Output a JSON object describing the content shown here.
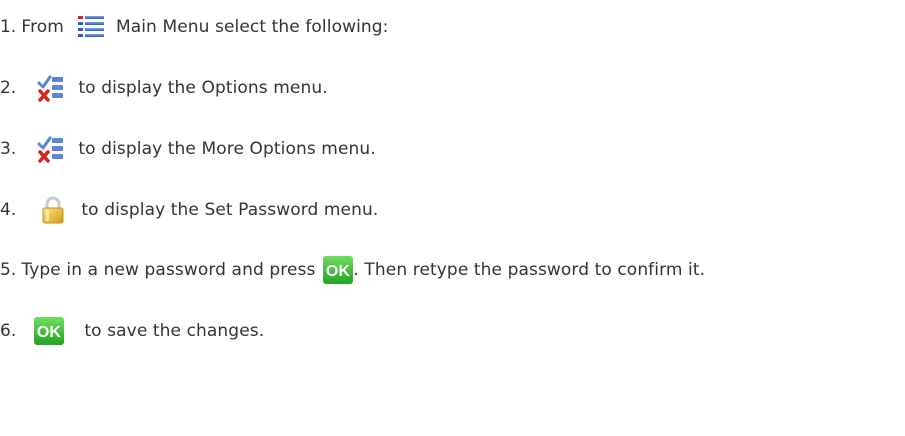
{
  "steps": [
    {
      "number": "1.",
      "prefix": "From",
      "icon": "main-menu-icon",
      "text": "Main Menu select the following:"
    },
    {
      "number": "2.",
      "icon": "options-checklist-icon",
      "text": "to display the Options menu."
    },
    {
      "number": "3.",
      "icon": "options-checklist-icon",
      "text": "to display the More Options menu."
    },
    {
      "number": "4.",
      "icon": "padlock-icon",
      "text": "to display the Set Password menu."
    },
    {
      "number": "5.",
      "text": "Type in a new password and press",
      "icon": "ok-button-icon",
      "ok_label": "OK",
      "suffix": ". Then retype the password to confirm it."
    },
    {
      "number": "6.",
      "icon": "ok-button-icon",
      "ok_label": "OK",
      "text": "to save the changes."
    }
  ],
  "colors": {
    "text": "#333333",
    "menu_icon_blue": "#3f6fd1",
    "check_blue": "#5b84d6",
    "cross_red": "#d9251d",
    "ok_green": "#3dbb3a",
    "lock_gold": "#e8b92e"
  }
}
